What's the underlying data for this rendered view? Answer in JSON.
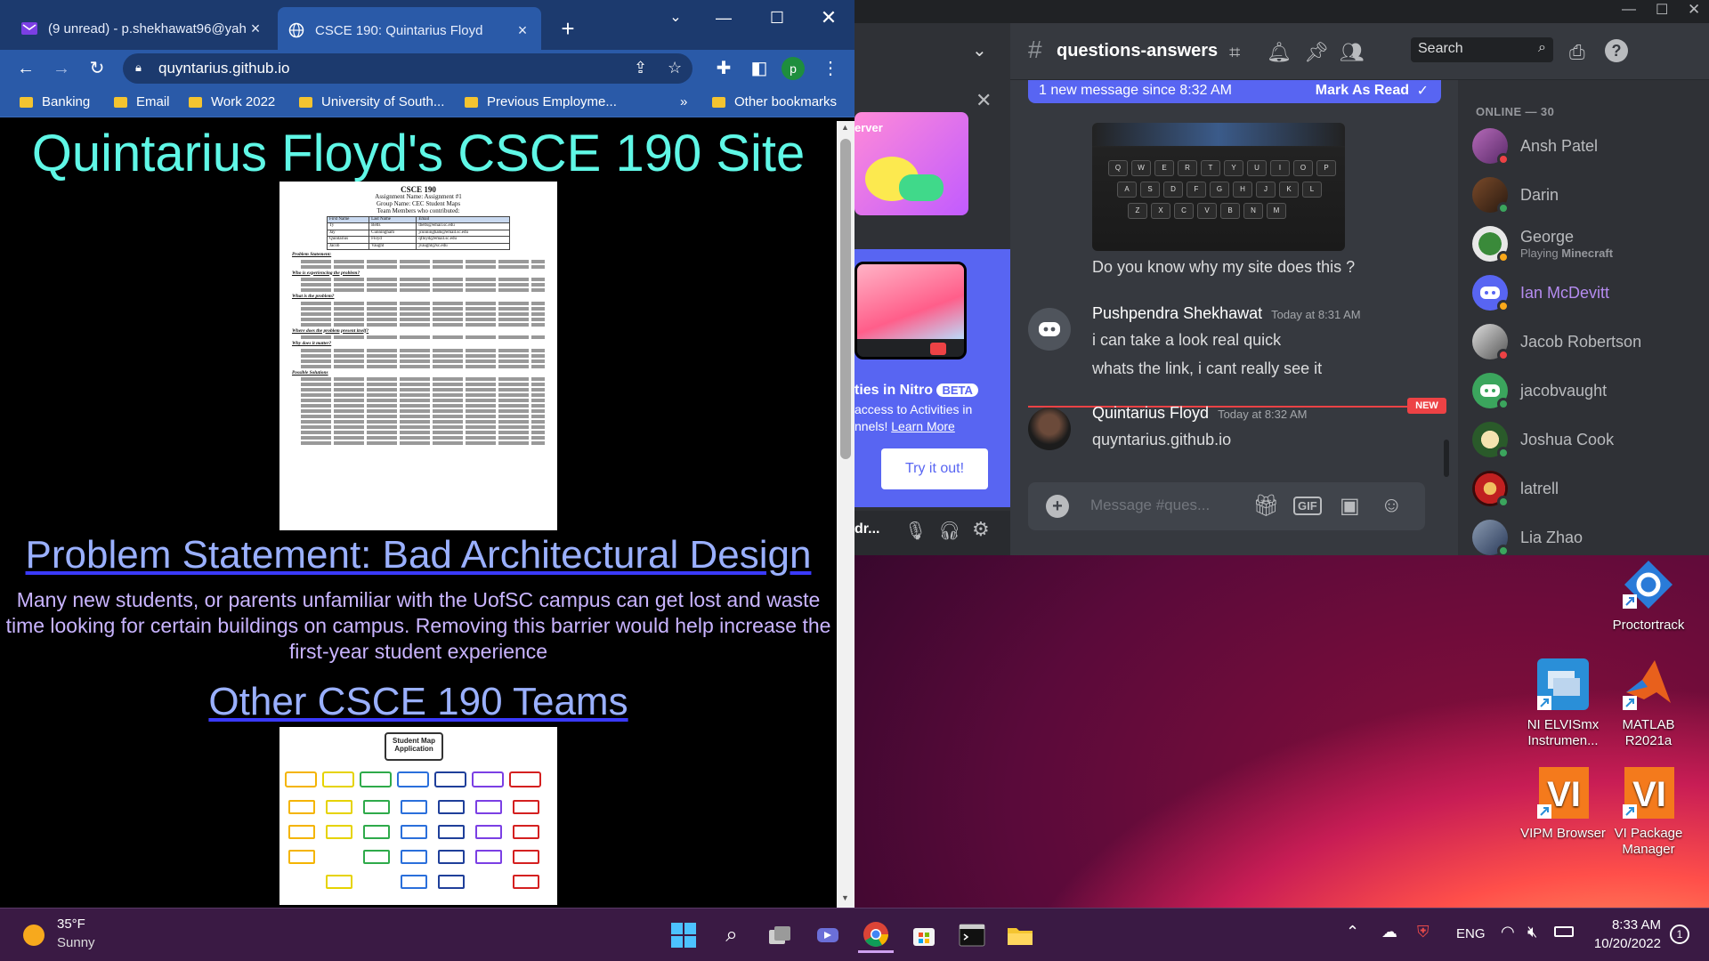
{
  "chrome": {
    "tabs": [
      {
        "title": "(9 unread) - p.shekhawat96@yah",
        "close": "×"
      },
      {
        "title": "CSCE 190: Quintarius Floyd",
        "close": "×"
      }
    ],
    "new_tab": "+",
    "url": "quyntarius.github.io",
    "profile": "p",
    "bookmarks": [
      "Banking",
      "Email",
      "Work 2022",
      "University of South...",
      "Previous Employme..."
    ],
    "bookmarks_more": "»",
    "other_bookmarks": "Other bookmarks"
  },
  "site": {
    "title": "Quintarius Floyd's CSCE 190 Site",
    "doc": {
      "heading": "CSCE 190",
      "line1": "Assignment Name: Assignment #1",
      "line2": "Group Name: CEC Student Maps",
      "line3": "Team Members who contributed:",
      "table_headers": [
        "First Name",
        "Last Name",
        "Email"
      ],
      "table_rows": [
        [
          "Ty",
          "Betts",
          "tbetts@email.sc.edu"
        ],
        [
          "Jay",
          "Cunningham",
          "jcunningham@email.sc.edu"
        ],
        [
          "Quintarius",
          "Floyd",
          "qfloyd@email.sc.edu"
        ],
        [
          "Jacob",
          "Vaught",
          "jvaught@sc.edu"
        ]
      ],
      "problem_label": "Problem Statement:",
      "sections": [
        "Who is experiencing the problem?",
        "What is the problem?",
        "Where does the problem present itself?",
        "Why does it matter?",
        "Possible Solutions"
      ]
    },
    "problem_heading": "Problem Statement: Bad Architectural Design",
    "problem_body": "Many new students, or parents unfamiliar with the UofSC campus can get lost and waste time looking for certain buildings on campus. Removing this barrier would help increase the first-year student experience",
    "teams_heading": "Other CSCE 190 Teams",
    "diagram_root": "Student Map Application"
  },
  "discord": {
    "channel": "questions-answers",
    "search_placeholder": "Search",
    "new_messages": "1 new message since 8:32 AM",
    "mark_as_read": "Mark As Read",
    "messages": [
      {
        "text": "Do you know why my site does this ?"
      },
      {
        "author": "Pushpendra Shekhawat",
        "time": "Today at 8:31 AM",
        "lines": [
          "i can take a look real quick",
          "whats the link, i cant really see it"
        ]
      },
      {
        "author": "Quintarius Floyd",
        "time": "Today at 8:32 AM",
        "lines": [
          "quyntarius.github.io"
        ]
      }
    ],
    "new_badge": "NEW",
    "message_placeholder": "Message #ques...",
    "gif_label": "GIF",
    "nitro": {
      "title": "ties in Nitro",
      "beta": "BETA",
      "text1": "access to Activities in",
      "text2": "nnels!",
      "learn_more": "Learn More",
      "cta": "Try it out!"
    },
    "user_short": "dr...",
    "server_banner": "erver",
    "members_header": "ONLINE — 30",
    "members": [
      {
        "name": "Ansh Patel"
      },
      {
        "name": "Darin"
      },
      {
        "name": "George",
        "activity_prefix": "Playing ",
        "activity": "Minecraft"
      },
      {
        "name": "Ian McDevitt"
      },
      {
        "name": "Jacob Robertson"
      },
      {
        "name": "jacobvaught"
      },
      {
        "name": "Joshua Cook"
      },
      {
        "name": "latrell"
      },
      {
        "name": "Lia Zhao"
      }
    ],
    "colors": {
      "blurple": "#5865f2",
      "online": "#3ba55d",
      "idle": "#faa81a",
      "dnd": "#ed4245"
    }
  },
  "desktop_icons": [
    {
      "label": "Proctortrack"
    },
    {
      "label": "NI ELVISmx Instrumen..."
    },
    {
      "label": "MATLAB R2021a"
    },
    {
      "label": "VIPM Browser"
    },
    {
      "label": "VI Package Manager"
    }
  ],
  "taskbar": {
    "weather_temp": "35°F",
    "weather_desc": "Sunny",
    "lang": "ENG",
    "time": "8:33 AM",
    "date": "10/20/2022",
    "notification_count": "1"
  }
}
